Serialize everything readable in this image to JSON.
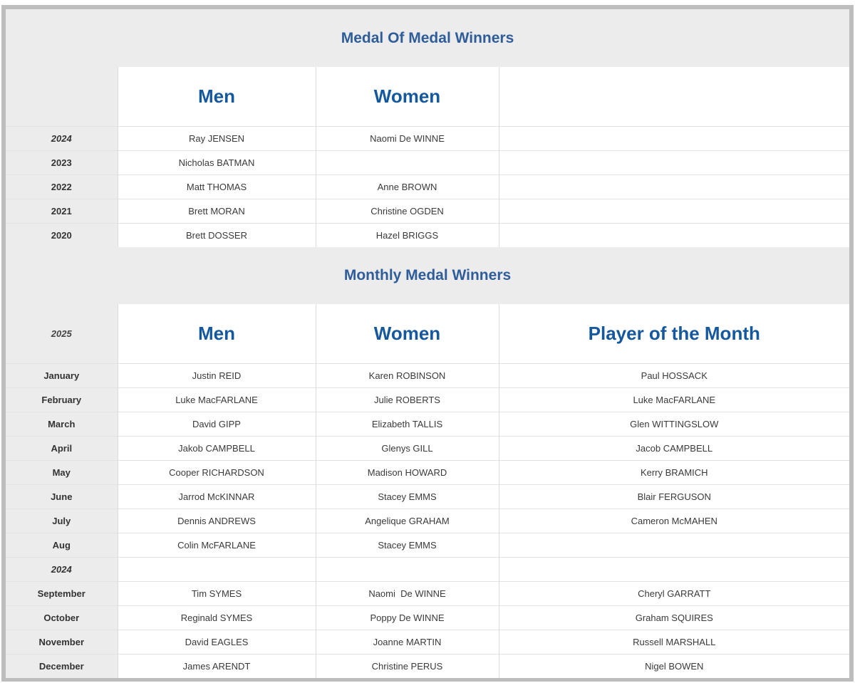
{
  "annual": {
    "title": "Medal Of Medal Winners",
    "header_label": "",
    "headers": [
      "Men",
      "Women",
      ""
    ],
    "rows": [
      {
        "label": "2024",
        "italic": true,
        "men": "Ray JENSEN",
        "women": "Naomi De WINNE",
        "potm": ""
      },
      {
        "label": "2023",
        "italic": false,
        "men": "Nicholas BATMAN",
        "women": "",
        "potm": ""
      },
      {
        "label": "2022",
        "italic": false,
        "men": "Matt THOMAS",
        "women": "Anne BROWN",
        "potm": ""
      },
      {
        "label": "2021",
        "italic": false,
        "men": "Brett MORAN",
        "women": "Christine OGDEN",
        "potm": ""
      },
      {
        "label": "2020",
        "italic": false,
        "men": "Brett DOSSER",
        "women": "Hazel BRIGGS",
        "potm": ""
      }
    ]
  },
  "monthly": {
    "title": "Monthly Medal Winners",
    "header_label": "2025",
    "headers": [
      "Men",
      "Women",
      "Player of the Month"
    ],
    "rows": [
      {
        "label": "January",
        "italic": false,
        "men": "Justin REID",
        "women": "Karen ROBINSON",
        "potm": "Paul HOSSACK"
      },
      {
        "label": "February",
        "italic": false,
        "men": "Luke MacFARLANE",
        "women": "Julie ROBERTS",
        "potm": "Luke MacFARLANE"
      },
      {
        "label": "March",
        "italic": false,
        "men": "David GIPP",
        "women": "Elizabeth TALLIS",
        "potm": "Glen WITTINGSLOW"
      },
      {
        "label": "April",
        "italic": false,
        "men": "Jakob CAMPBELL",
        "women": "Glenys GILL",
        "potm": "Jacob CAMPBELL"
      },
      {
        "label": "May",
        "italic": false,
        "men": "Cooper RICHARDSON",
        "women": "Madison HOWARD",
        "potm": "Kerry BRAMICH"
      },
      {
        "label": "June",
        "italic": false,
        "men": "Jarrod McKINNAR",
        "women": "Stacey EMMS",
        "potm": "Blair FERGUSON"
      },
      {
        "label": "July",
        "italic": false,
        "men": "Dennis ANDREWS",
        "women": "Angelique GRAHAM",
        "potm": "Cameron McMAHEN"
      },
      {
        "label": "Aug",
        "italic": false,
        "men": "Colin McFARLANE",
        "women": "Stacey EMMS",
        "potm": ""
      },
      {
        "label": "2024",
        "italic": true,
        "men": "",
        "women": "",
        "potm": ""
      },
      {
        "label": "September",
        "italic": false,
        "men": "Tim SYMES",
        "women": "Naomi  De WINNE",
        "potm": "Cheryl GARRATT"
      },
      {
        "label": "October",
        "italic": false,
        "men": "Reginald SYMES",
        "women": "Poppy De WINNE",
        "potm": "Graham SQUIRES"
      },
      {
        "label": "November",
        "italic": false,
        "men": "David EAGLES",
        "women": "Joanne MARTIN",
        "potm": "Russell MARSHALL"
      },
      {
        "label": "December",
        "italic": false,
        "men": "James ARENDT",
        "women": "Christine PERUS",
        "potm": "Nigel BOWEN"
      }
    ]
  }
}
